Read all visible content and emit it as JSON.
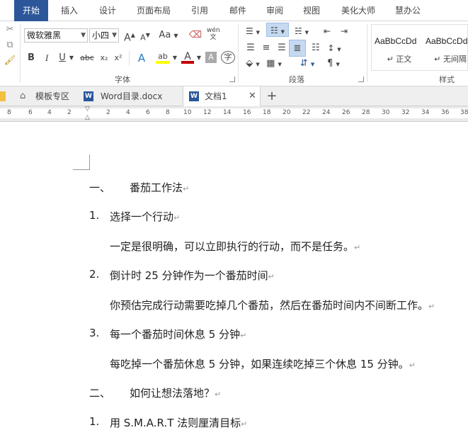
{
  "ribbon_tabs": [
    "开始",
    "插入",
    "设计",
    "页面布局",
    "引用",
    "邮件",
    "审阅",
    "视图",
    "美化大师",
    "慧办公"
  ],
  "font_group": {
    "font_name": "微软雅黑",
    "font_size": "小四",
    "label": "字体",
    "buttons": [
      "A",
      "A",
      "Aa",
      "wén",
      "B",
      "I",
      "U",
      "abc",
      "x₂",
      "x²",
      "A",
      "ab",
      "A",
      "A",
      "字"
    ]
  },
  "paragraph_group": {
    "label": "段落"
  },
  "styles_group": {
    "label": "样式",
    "items": [
      {
        "sample": "AaBbCcDd",
        "name": "↵ 正文"
      },
      {
        "sample": "AaBbCcDd",
        "name": "↵ 无间隔"
      }
    ]
  },
  "doc_tabs": [
    {
      "label": "模板专区"
    },
    {
      "label": "Word目录.docx"
    },
    {
      "label": "文档1"
    }
  ],
  "ruler_ticks": [
    "8",
    "6",
    "4",
    "2",
    "2",
    "4",
    "6",
    "8",
    "10",
    "12",
    "14",
    "16",
    "18",
    "20",
    "22",
    "24",
    "26",
    "28",
    "30",
    "32",
    "34",
    "36",
    "38"
  ],
  "document": {
    "lines": [
      {
        "marker": "一、",
        "text": "番茄工作法",
        "mark": "↵"
      },
      {
        "marker": "1.",
        "text": "选择一个行动",
        "mark": "↵"
      },
      {
        "marker": "",
        "text": "一定是很明确，可以立即执行的行动，而不是任务。",
        "mark": "↵"
      },
      {
        "marker": "2.",
        "text": "倒计时 25 分钟作为一个番茄时间",
        "mark": "↵"
      },
      {
        "marker": "",
        "text": "你预估完成行动需要吃掉几个番茄，然后在番茄时间内不间断工作。",
        "mark": "↵"
      },
      {
        "marker": "3.",
        "text": "每一个番茄时间休息 5 分钟",
        "mark": "↵"
      },
      {
        "marker": "",
        "text": "每吃掉一个番茄休息 5 分钟，如果连续吃掉三个休息 15 分钟。",
        "mark": "↵"
      },
      {
        "marker": "二、",
        "text": "如何让想法落地？",
        "mark": "↵"
      },
      {
        "marker": "1.",
        "text": "用 S.M.A.R.T 法则厘清目标",
        "mark": "↵"
      }
    ]
  },
  "colors": {
    "accent": "#2b579a",
    "highlight": "#ffff00",
    "font_color": "#c00000"
  }
}
